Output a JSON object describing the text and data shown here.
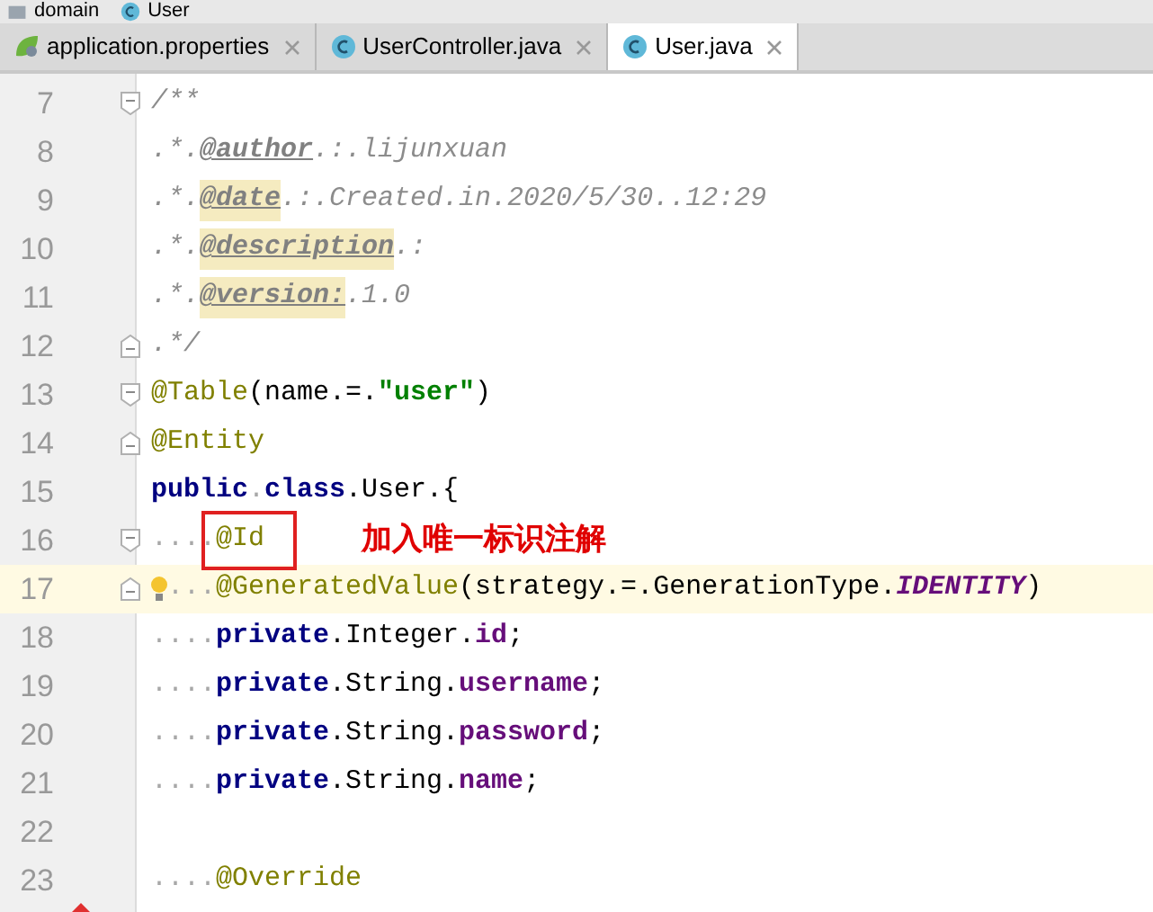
{
  "breadcrumb": [
    {
      "label": "domain"
    },
    {
      "label": "User"
    }
  ],
  "tabs": [
    {
      "label": "application.properties",
      "selected": false
    },
    {
      "label": "UserController.java",
      "selected": false
    },
    {
      "label": "User.java",
      "selected": true
    }
  ],
  "lines": [
    {
      "number": "7",
      "fold_start": true,
      "fold_end": false,
      "current": false,
      "tokens": [
        {
          "kind": "comment",
          "text": "/**"
        }
      ]
    },
    {
      "number": "8",
      "fold_start": false,
      "fold_end": false,
      "current": false,
      "tokens": [
        {
          "kind": "comment",
          "text": ".*."
        },
        {
          "kind": "doctag",
          "text": "@author",
          "highlighted": false
        },
        {
          "kind": "comment",
          "text": ".:.lijunxuan"
        }
      ]
    },
    {
      "number": "9",
      "fold_start": false,
      "fold_end": false,
      "current": false,
      "tokens": [
        {
          "kind": "comment",
          "text": ".*."
        },
        {
          "kind": "doctag",
          "text": "@date",
          "highlighted": true
        },
        {
          "kind": "comment",
          "text": ".:.Created.in.2020/5/30..12:29"
        }
      ]
    },
    {
      "number": "10",
      "fold_start": false,
      "fold_end": false,
      "current": false,
      "tokens": [
        {
          "kind": "comment",
          "text": ".*."
        },
        {
          "kind": "doctag",
          "text": "@description",
          "highlighted": true
        },
        {
          "kind": "comment",
          "text": ".:"
        }
      ]
    },
    {
      "number": "11",
      "fold_start": false,
      "fold_end": false,
      "current": false,
      "tokens": [
        {
          "kind": "comment",
          "text": ".*."
        },
        {
          "kind": "doctag",
          "text": "@version:",
          "highlighted": true
        },
        {
          "kind": "comment",
          "text": ".1.0"
        }
      ]
    },
    {
      "number": "12",
      "fold_start": false,
      "fold_end": true,
      "current": false,
      "tokens": [
        {
          "kind": "comment",
          "text": ".*/"
        }
      ]
    },
    {
      "number": "13",
      "fold_start": true,
      "fold_end": false,
      "current": false,
      "tokens": [
        {
          "kind": "annotation",
          "text": "@Table"
        },
        {
          "kind": "plain",
          "text": "(name.=."
        },
        {
          "kind": "string",
          "text": "\"user\""
        },
        {
          "kind": "plain",
          "text": ")"
        }
      ]
    },
    {
      "number": "14",
      "fold_start": false,
      "fold_end": true,
      "current": false,
      "tokens": [
        {
          "kind": "annotation",
          "text": "@Entity"
        }
      ]
    },
    {
      "number": "15",
      "fold_start": false,
      "fold_end": false,
      "current": false,
      "tokens": [
        {
          "kind": "keyword",
          "text": "public"
        },
        {
          "kind": "space",
          "text": "."
        },
        {
          "kind": "keyword",
          "text": "class"
        },
        {
          "kind": "plain",
          "text": ".User.{"
        }
      ]
    },
    {
      "number": "16",
      "fold_start": true,
      "fold_end": false,
      "current": false,
      "note": "加入唯一标识注解",
      "tokens": [
        {
          "kind": "space",
          "text": "...."
        },
        {
          "kind": "annotation",
          "text": "@Id",
          "boxed": true
        }
      ]
    },
    {
      "number": "17",
      "fold_start": false,
      "fold_end": true,
      "current": true,
      "bulb": true,
      "tokens": [
        {
          "kind": "space",
          "text": "..."
        },
        {
          "kind": "annotation",
          "text": "@GeneratedValue"
        },
        {
          "kind": "plain",
          "text": "(strategy.=.GenerationType."
        },
        {
          "kind": "constant",
          "text": "IDENTITY"
        },
        {
          "kind": "plain",
          "text": ")"
        }
      ]
    },
    {
      "number": "18",
      "fold_start": false,
      "fold_end": false,
      "current": false,
      "tokens": [
        {
          "kind": "space",
          "text": "...."
        },
        {
          "kind": "keyword",
          "text": "private"
        },
        {
          "kind": "plain",
          "text": ".Integer."
        },
        {
          "kind": "field",
          "text": "id"
        },
        {
          "kind": "plain",
          "text": ";"
        }
      ]
    },
    {
      "number": "19",
      "fold_start": false,
      "fold_end": false,
      "current": false,
      "tokens": [
        {
          "kind": "space",
          "text": "...."
        },
        {
          "kind": "keyword",
          "text": "private"
        },
        {
          "kind": "plain",
          "text": ".String."
        },
        {
          "kind": "field",
          "text": "username"
        },
        {
          "kind": "plain",
          "text": ";"
        }
      ]
    },
    {
      "number": "20",
      "fold_start": false,
      "fold_end": false,
      "current": false,
      "tokens": [
        {
          "kind": "space",
          "text": "...."
        },
        {
          "kind": "keyword",
          "text": "private"
        },
        {
          "kind": "plain",
          "text": ".String."
        },
        {
          "kind": "field",
          "text": "password"
        },
        {
          "kind": "plain",
          "text": ";"
        }
      ]
    },
    {
      "number": "21",
      "fold_start": false,
      "fold_end": false,
      "current": false,
      "tokens": [
        {
          "kind": "space",
          "text": "...."
        },
        {
          "kind": "keyword",
          "text": "private"
        },
        {
          "kind": "plain",
          "text": ".String."
        },
        {
          "kind": "field",
          "text": "name"
        },
        {
          "kind": "plain",
          "text": ";"
        }
      ]
    },
    {
      "number": "22",
      "fold_start": false,
      "fold_end": false,
      "current": false
    },
    {
      "number": "23",
      "fold_start": false,
      "fold_end": false,
      "current": false,
      "tokens": [
        {
          "kind": "space",
          "text": "...."
        },
        {
          "kind": "annotation",
          "text": "@Override"
        }
      ]
    }
  ]
}
